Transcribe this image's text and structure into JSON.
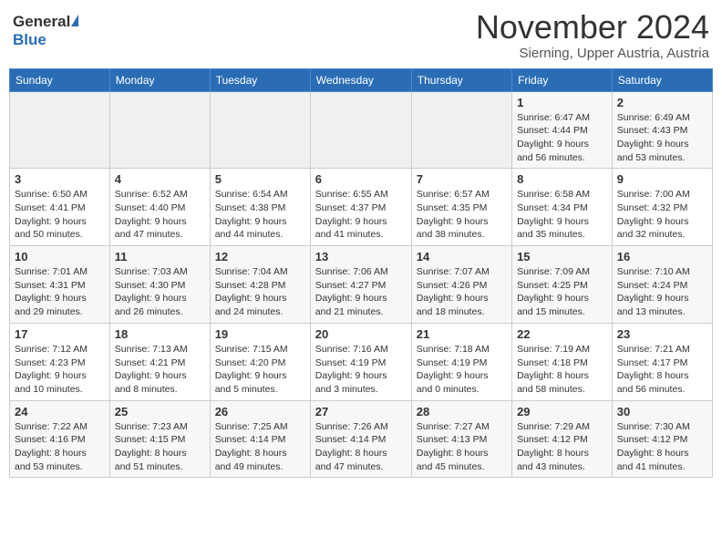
{
  "header": {
    "logo_general": "General",
    "logo_blue": "Blue",
    "month_title": "November 2024",
    "location": "Sierning, Upper Austria, Austria"
  },
  "weekdays": [
    "Sunday",
    "Monday",
    "Tuesday",
    "Wednesday",
    "Thursday",
    "Friday",
    "Saturday"
  ],
  "rows": [
    [
      {
        "day": "",
        "details": ""
      },
      {
        "day": "",
        "details": ""
      },
      {
        "day": "",
        "details": ""
      },
      {
        "day": "",
        "details": ""
      },
      {
        "day": "",
        "details": ""
      },
      {
        "day": "1",
        "details": "Sunrise: 6:47 AM\nSunset: 4:44 PM\nDaylight: 9 hours\nand 56 minutes."
      },
      {
        "day": "2",
        "details": "Sunrise: 6:49 AM\nSunset: 4:43 PM\nDaylight: 9 hours\nand 53 minutes."
      }
    ],
    [
      {
        "day": "3",
        "details": "Sunrise: 6:50 AM\nSunset: 4:41 PM\nDaylight: 9 hours\nand 50 minutes."
      },
      {
        "day": "4",
        "details": "Sunrise: 6:52 AM\nSunset: 4:40 PM\nDaylight: 9 hours\nand 47 minutes."
      },
      {
        "day": "5",
        "details": "Sunrise: 6:54 AM\nSunset: 4:38 PM\nDaylight: 9 hours\nand 44 minutes."
      },
      {
        "day": "6",
        "details": "Sunrise: 6:55 AM\nSunset: 4:37 PM\nDaylight: 9 hours\nand 41 minutes."
      },
      {
        "day": "7",
        "details": "Sunrise: 6:57 AM\nSunset: 4:35 PM\nDaylight: 9 hours\nand 38 minutes."
      },
      {
        "day": "8",
        "details": "Sunrise: 6:58 AM\nSunset: 4:34 PM\nDaylight: 9 hours\nand 35 minutes."
      },
      {
        "day": "9",
        "details": "Sunrise: 7:00 AM\nSunset: 4:32 PM\nDaylight: 9 hours\nand 32 minutes."
      }
    ],
    [
      {
        "day": "10",
        "details": "Sunrise: 7:01 AM\nSunset: 4:31 PM\nDaylight: 9 hours\nand 29 minutes."
      },
      {
        "day": "11",
        "details": "Sunrise: 7:03 AM\nSunset: 4:30 PM\nDaylight: 9 hours\nand 26 minutes."
      },
      {
        "day": "12",
        "details": "Sunrise: 7:04 AM\nSunset: 4:28 PM\nDaylight: 9 hours\nand 24 minutes."
      },
      {
        "day": "13",
        "details": "Sunrise: 7:06 AM\nSunset: 4:27 PM\nDaylight: 9 hours\nand 21 minutes."
      },
      {
        "day": "14",
        "details": "Sunrise: 7:07 AM\nSunset: 4:26 PM\nDaylight: 9 hours\nand 18 minutes."
      },
      {
        "day": "15",
        "details": "Sunrise: 7:09 AM\nSunset: 4:25 PM\nDaylight: 9 hours\nand 15 minutes."
      },
      {
        "day": "16",
        "details": "Sunrise: 7:10 AM\nSunset: 4:24 PM\nDaylight: 9 hours\nand 13 minutes."
      }
    ],
    [
      {
        "day": "17",
        "details": "Sunrise: 7:12 AM\nSunset: 4:23 PM\nDaylight: 9 hours\nand 10 minutes."
      },
      {
        "day": "18",
        "details": "Sunrise: 7:13 AM\nSunset: 4:21 PM\nDaylight: 9 hours\nand 8 minutes."
      },
      {
        "day": "19",
        "details": "Sunrise: 7:15 AM\nSunset: 4:20 PM\nDaylight: 9 hours\nand 5 minutes."
      },
      {
        "day": "20",
        "details": "Sunrise: 7:16 AM\nSunset: 4:19 PM\nDaylight: 9 hours\nand 3 minutes."
      },
      {
        "day": "21",
        "details": "Sunrise: 7:18 AM\nSunset: 4:19 PM\nDaylight: 9 hours\nand 0 minutes."
      },
      {
        "day": "22",
        "details": "Sunrise: 7:19 AM\nSunset: 4:18 PM\nDaylight: 8 hours\nand 58 minutes."
      },
      {
        "day": "23",
        "details": "Sunrise: 7:21 AM\nSunset: 4:17 PM\nDaylight: 8 hours\nand 56 minutes."
      }
    ],
    [
      {
        "day": "24",
        "details": "Sunrise: 7:22 AM\nSunset: 4:16 PM\nDaylight: 8 hours\nand 53 minutes."
      },
      {
        "day": "25",
        "details": "Sunrise: 7:23 AM\nSunset: 4:15 PM\nDaylight: 8 hours\nand 51 minutes."
      },
      {
        "day": "26",
        "details": "Sunrise: 7:25 AM\nSunset: 4:14 PM\nDaylight: 8 hours\nand 49 minutes."
      },
      {
        "day": "27",
        "details": "Sunrise: 7:26 AM\nSunset: 4:14 PM\nDaylight: 8 hours\nand 47 minutes."
      },
      {
        "day": "28",
        "details": "Sunrise: 7:27 AM\nSunset: 4:13 PM\nDaylight: 8 hours\nand 45 minutes."
      },
      {
        "day": "29",
        "details": "Sunrise: 7:29 AM\nSunset: 4:12 PM\nDaylight: 8 hours\nand 43 minutes."
      },
      {
        "day": "30",
        "details": "Sunrise: 7:30 AM\nSunset: 4:12 PM\nDaylight: 8 hours\nand 41 minutes."
      }
    ]
  ]
}
